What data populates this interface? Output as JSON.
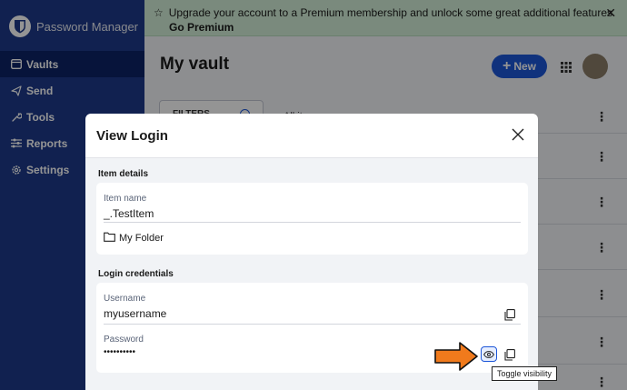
{
  "sidebar": {
    "app_name": "Password Manager",
    "items": [
      {
        "label": "Vaults",
        "icon": "vault-icon",
        "active": true
      },
      {
        "label": "Send",
        "icon": "send-icon"
      },
      {
        "label": "Tools",
        "icon": "wrench-icon"
      },
      {
        "label": "Reports",
        "icon": "sliders-icon"
      },
      {
        "label": "Settings",
        "icon": "gear-icon"
      }
    ]
  },
  "banner": {
    "message": "Upgrade your account to a Premium membership and unlock some great additional features.",
    "link": "Go Premium",
    "close": "✕"
  },
  "header": {
    "title": "My vault",
    "new_label": "New"
  },
  "list": {
    "filters_label": "FILTERS",
    "column_header": "All items"
  },
  "dialog": {
    "title": "View Login",
    "item_details_label": "Item details",
    "item_name_label": "Item name",
    "item_name_value": "_.TestItem",
    "folder_value": "My Folder",
    "login_credentials_label": "Login credentials",
    "username_label": "Username",
    "username_value": "myusername",
    "password_label": "Password",
    "password_value": "••••••••••"
  },
  "tooltip": {
    "text": "Toggle visibility"
  },
  "colors": {
    "sidebar": "#1e3a8a",
    "accent": "#1c56d8",
    "banner": "#d3eed7",
    "arrow": "#f07a1c"
  }
}
